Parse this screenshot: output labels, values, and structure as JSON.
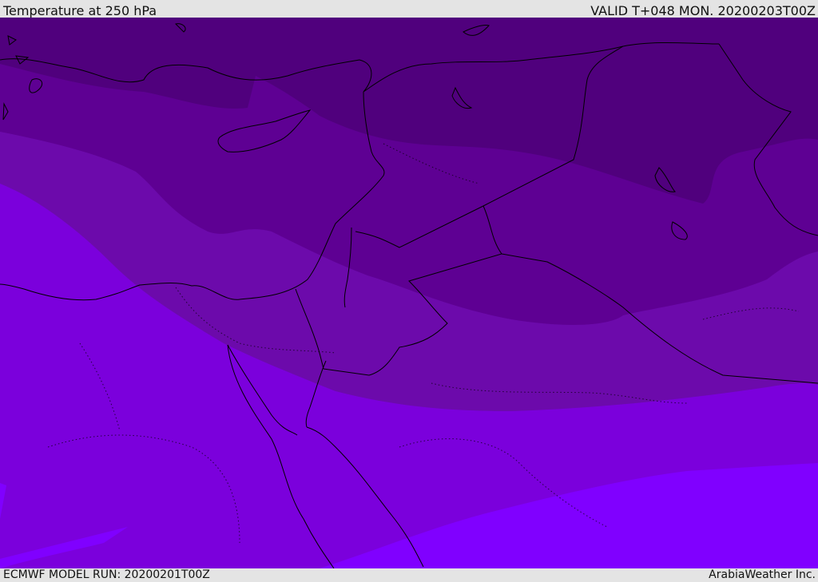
{
  "header": {
    "title": "Temperature at 250 hPa",
    "valid_time": "VALID T+048 MON. 20200203T00Z"
  },
  "footer": {
    "model_run": "ECMWF MODEL RUN: 20200201T00Z",
    "credit": "ArabiaWeather Inc."
  },
  "map": {
    "colors": {
      "darkest": "#50007d",
      "dark": "#5e0093",
      "mid": "#6c0aab",
      "light": "#7b00dc",
      "lightest": "#8000ff",
      "border": "#000000"
    }
  }
}
